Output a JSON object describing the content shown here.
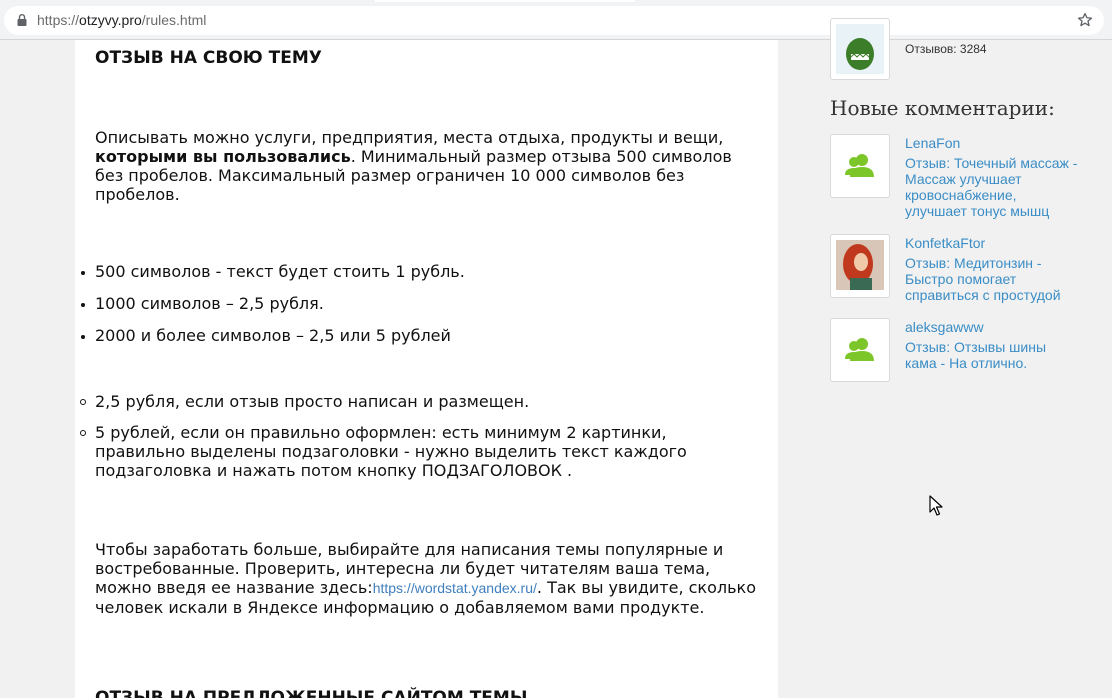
{
  "browser": {
    "url_scheme": "https://",
    "url_host": "otzyvy.pro",
    "url_path": "/rules.html",
    "icons": [
      "lock-icon",
      "star-icon"
    ]
  },
  "article": {
    "heading": "ОТЗЫВ НА СВОЮ ТЕМУ",
    "p1_start": "Описывать можно услуги, предприятия, места отдыха, продукты и вещи, ",
    "p1_bold": "которыми вы пользовались",
    "p1_end": ". Минимальный размер отзыва 500 символов без пробелов. Максимальный размер ограничен 10 000 символов без пробелов.",
    "bullets": [
      "500 символов - текст будет стоить 1 рубль.",
      "1000 символов – 2,5 рубля.",
      "2000 и более символов – 2,5 или 5 рублей"
    ],
    "sub_bullets": [
      "2,5 рубля, если отзыв просто написан и размещен.",
      "5 рублей, если он правильно оформлен: есть минимум 2 картинки, правильно выделены подзаголовки - нужно выделить текст каждого подзаголовка и нажать потом кнопку ПОДЗАГОЛОВОК ."
    ],
    "p2_start": "Чтобы заработать больше, выбирайте для написания темы популярные и востребованные. Проверить, интересна ли будет читателям ваша тема, можно введя ее название здесь:",
    "p2_link": "https://wordstat.yandex.ru/",
    "p2_end": ". Так вы увидите, сколько человек искали в Яндексе информацию о добавляемом вами продукте.",
    "next_heading": "ОТЗЫВ НА ПРЕДЛОЖЕННЫЕ САЙТОМ ТЕМЫ"
  },
  "sidebar": {
    "top_user_count": "Отзывов: 3284",
    "title": "Новые комментарии:",
    "comments": [
      {
        "author": "LenaFon",
        "text": "Отзыв: Точечный массаж - Массаж улучшает кровоснабжение, улучшает тонус мышц",
        "avatar": "user-icon"
      },
      {
        "author": "KonfetkaFtor",
        "text": "Отзыв: Медитонзин - Быстро помогает справиться с простудой",
        "avatar": "photo"
      },
      {
        "author": "aleksgawww",
        "text": "Отзыв: Отзывы шины кама - На отлично.",
        "avatar": "user-icon"
      }
    ]
  },
  "colors": {
    "link": "#3a8dc6",
    "user_icon": "#7cc629",
    "page_bg": "#f1f1f1"
  }
}
